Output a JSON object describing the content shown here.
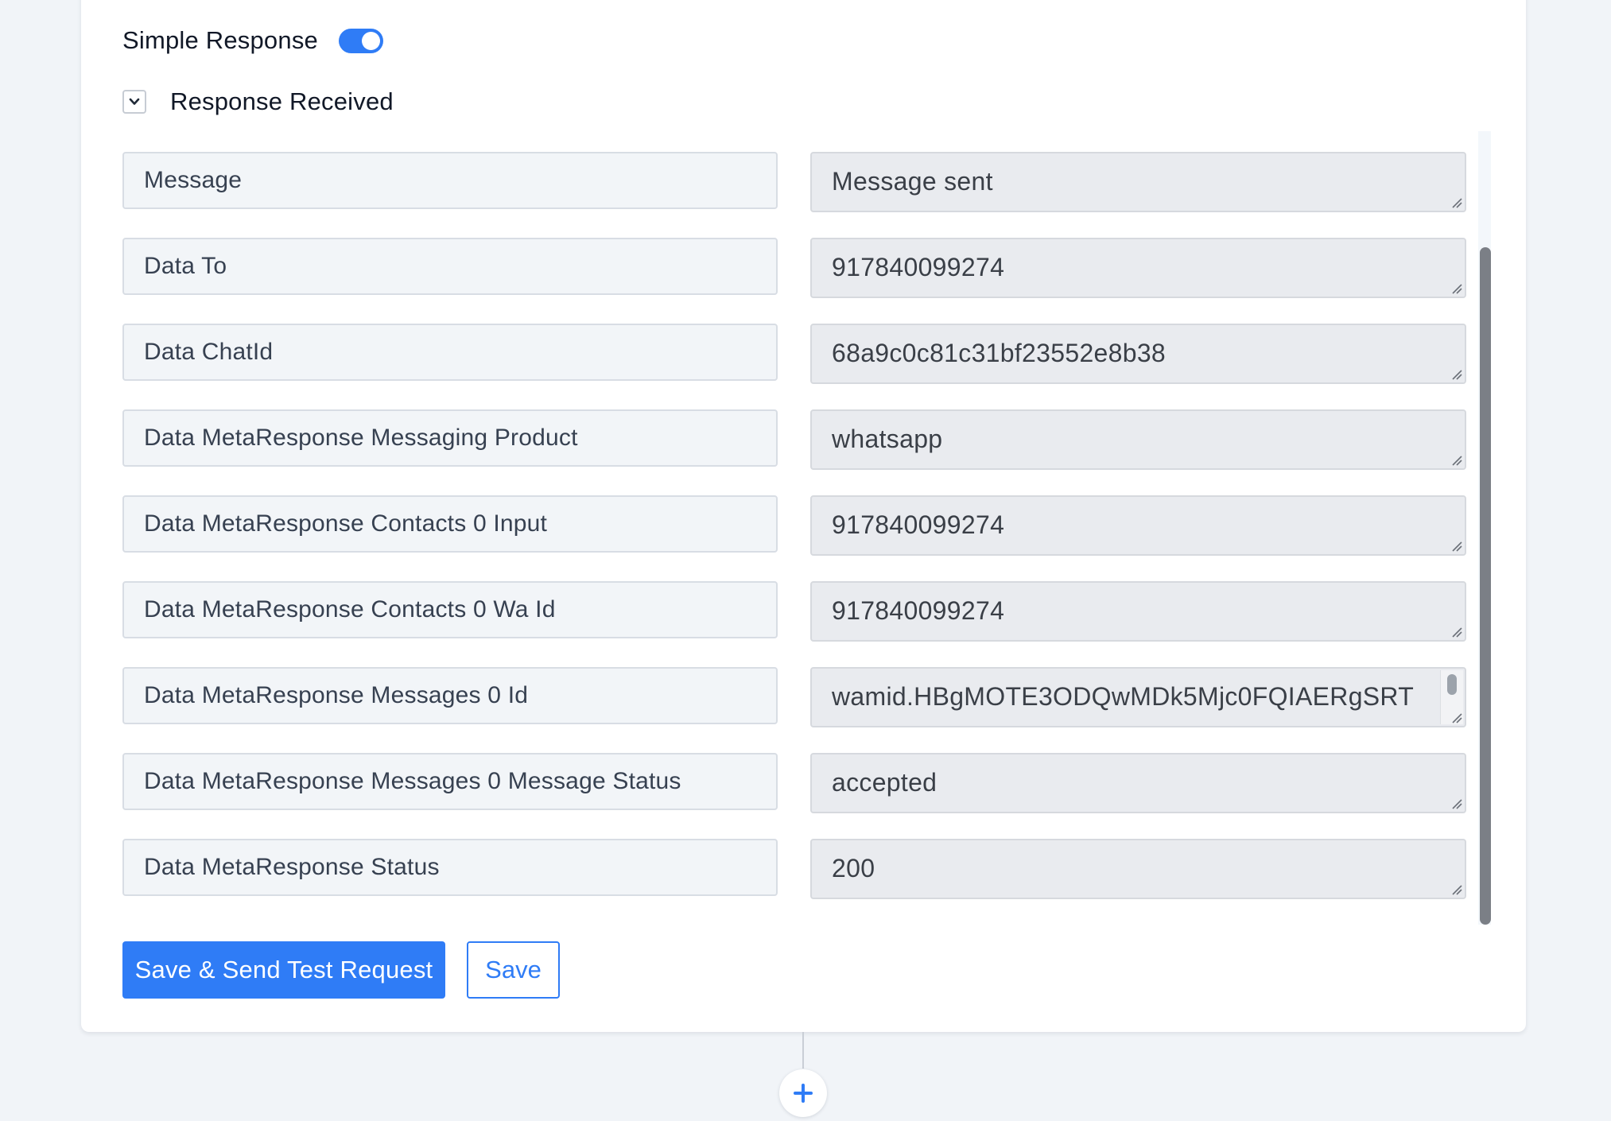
{
  "simple_response": {
    "label": "Simple Response",
    "enabled": true
  },
  "response_received": {
    "label": "Response Received",
    "icon": "chevron-down-icon"
  },
  "fields": [
    {
      "key": "Message",
      "value": "Message sent"
    },
    {
      "key": "Data To",
      "value": "917840099274"
    },
    {
      "key": "Data ChatId",
      "value": "68a9c0c81c31bf23552e8b38"
    },
    {
      "key": "Data MetaResponse Messaging Product",
      "value": "whatsapp"
    },
    {
      "key": "Data MetaResponse Contacts 0 Input",
      "value": "917840099274"
    },
    {
      "key": "Data MetaResponse Contacts 0 Wa Id",
      "value": "917840099274"
    },
    {
      "key": "Data MetaResponse Messages 0 Id",
      "value": "wamid.HBgMOTE3ODQwMDk5Mjc0FQIAERgSRT"
    },
    {
      "key": "Data MetaResponse Messages 0 Message Status",
      "value": "accepted"
    },
    {
      "key": "Data MetaResponse Status",
      "value": "200"
    }
  ],
  "buttons": {
    "save_send": "Save & Send Test Request",
    "save": "Save"
  },
  "add_step_icon": "plus-icon",
  "colors": {
    "accent": "#2f7cf6",
    "background": "#f1f4f8",
    "key_field_bg": "#f2f5f8",
    "value_field_bg": "#e9ebef"
  }
}
